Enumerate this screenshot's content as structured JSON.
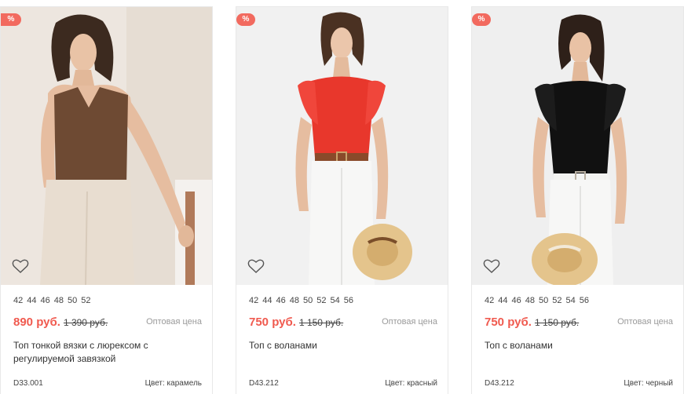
{
  "products": [
    {
      "badge": "%",
      "sizes": [
        "42",
        "44",
        "46",
        "48",
        "50",
        "52"
      ],
      "price": "890 руб.",
      "old_price": "1 390 руб.",
      "wholesale_label": "Оптовая цена",
      "title": "Топ тонкой вязки с люрексом с регулируемой завязкой",
      "sku": "D33.001",
      "color": "Цвет: карамель",
      "top_color": "#6e4a33"
    },
    {
      "badge": "%",
      "sizes": [
        "42",
        "44",
        "46",
        "48",
        "50",
        "52",
        "54",
        "56"
      ],
      "price": "750 руб.",
      "old_price": "1 150 руб.",
      "wholesale_label": "Оптовая цена",
      "title": "Топ с воланами",
      "sku": "D43.212",
      "color": "Цвет: красный",
      "top_color": "#e8372c"
    },
    {
      "badge": "%",
      "sizes": [
        "42",
        "44",
        "46",
        "48",
        "50",
        "52",
        "54",
        "56"
      ],
      "price": "750 руб.",
      "old_price": "1 150 руб.",
      "wholesale_label": "Оптовая цена",
      "title": "Топ с воланами",
      "sku": "D43.212",
      "color": "Цвет: черный",
      "top_color": "#111111"
    }
  ],
  "colors": {
    "accent": "#f05a4f",
    "badge": "#f26a5f"
  }
}
